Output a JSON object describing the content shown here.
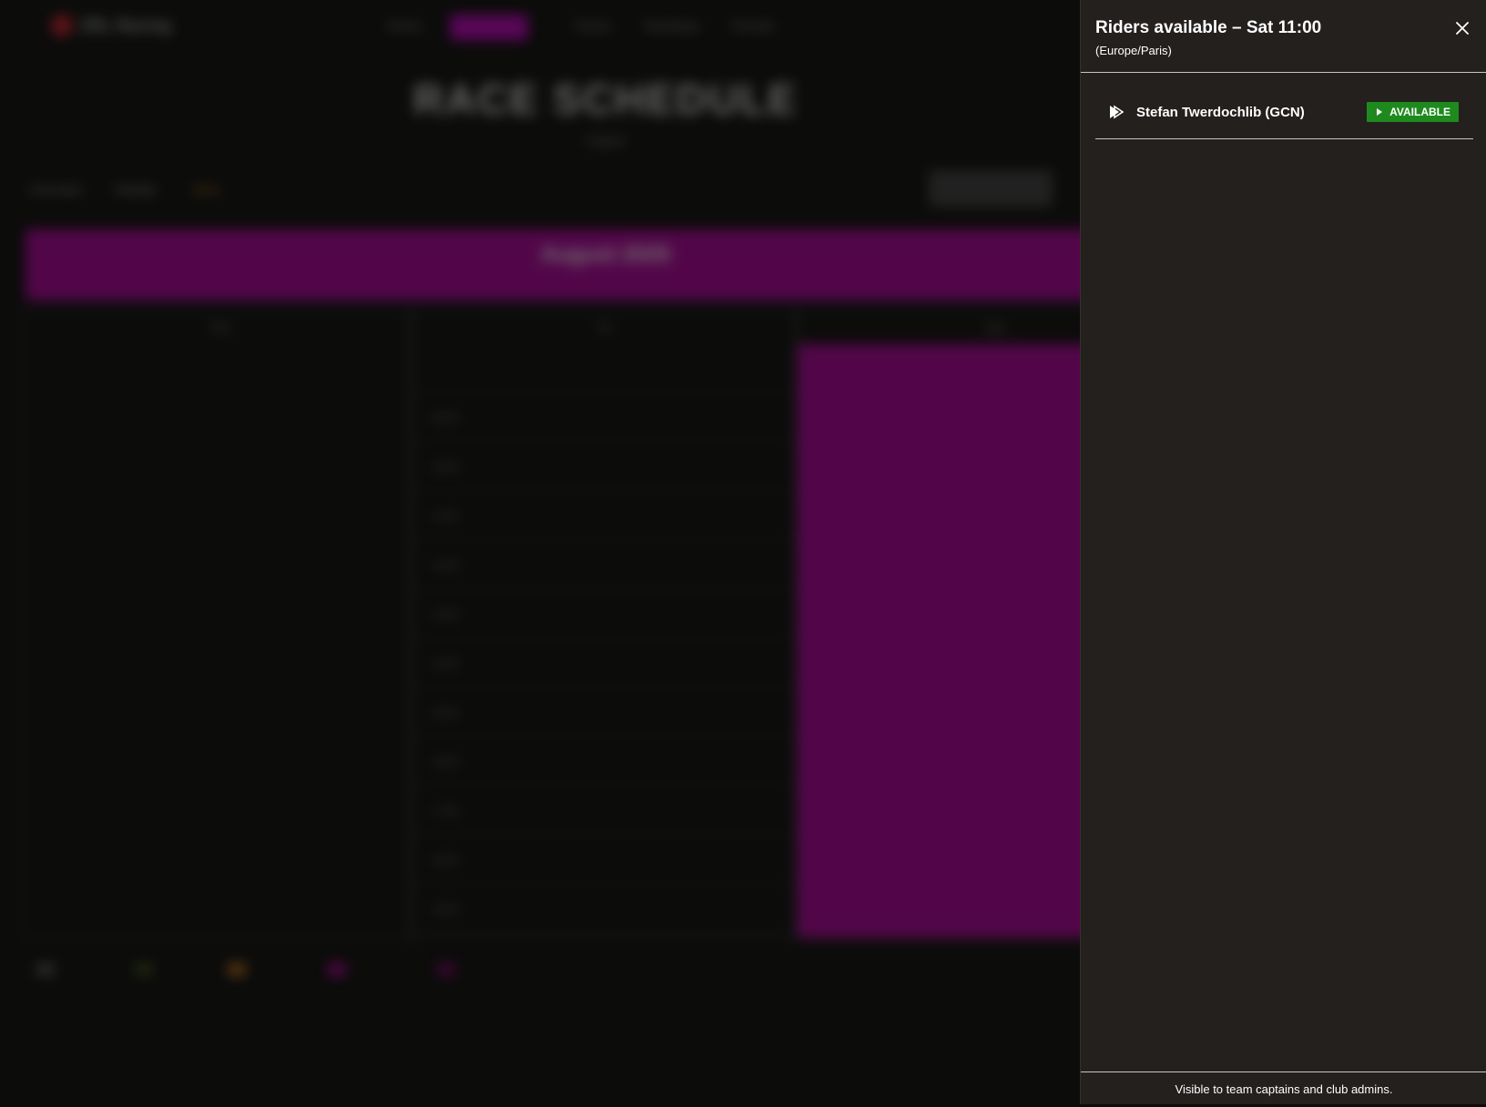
{
  "background": {
    "logo_text": "ZRL Racing",
    "nav_links": [
      "Series",
      "Races",
      "Teams",
      "Standings",
      "Results"
    ],
    "page_title": "RACE SCHEDULE",
    "page_subtitle": "August",
    "filters": [
      "Overview",
      "Weekly",
      "Mine"
    ],
    "action_button": "Add Rider",
    "month_title": "August 2025",
    "day_headers": [
      "Thu",
      "Fri",
      "Sat"
    ],
    "time_slots": [
      "",
      "09:00",
      "10:00",
      "11:00",
      "12:00",
      "13:00",
      "14:00",
      "15:00",
      "16:00",
      "17:00",
      "18:00",
      "19:00"
    ],
    "colors": {
      "accent": "#b3009f",
      "brand_red": "#d1202e",
      "filter_active": "#d68a12"
    }
  },
  "drawer": {
    "title": "Riders available – Sat 11:00",
    "timezone": "(Europe/Paris)",
    "close_icon": "close-icon",
    "riders": [
      {
        "name": "Stefan Twerdochlib (GCN)",
        "icon": "play-forward-icon",
        "status": "AVAILABLE",
        "status_color": "#1e8a1e"
      }
    ],
    "footer_note": "Visible to team captains and club admins."
  }
}
